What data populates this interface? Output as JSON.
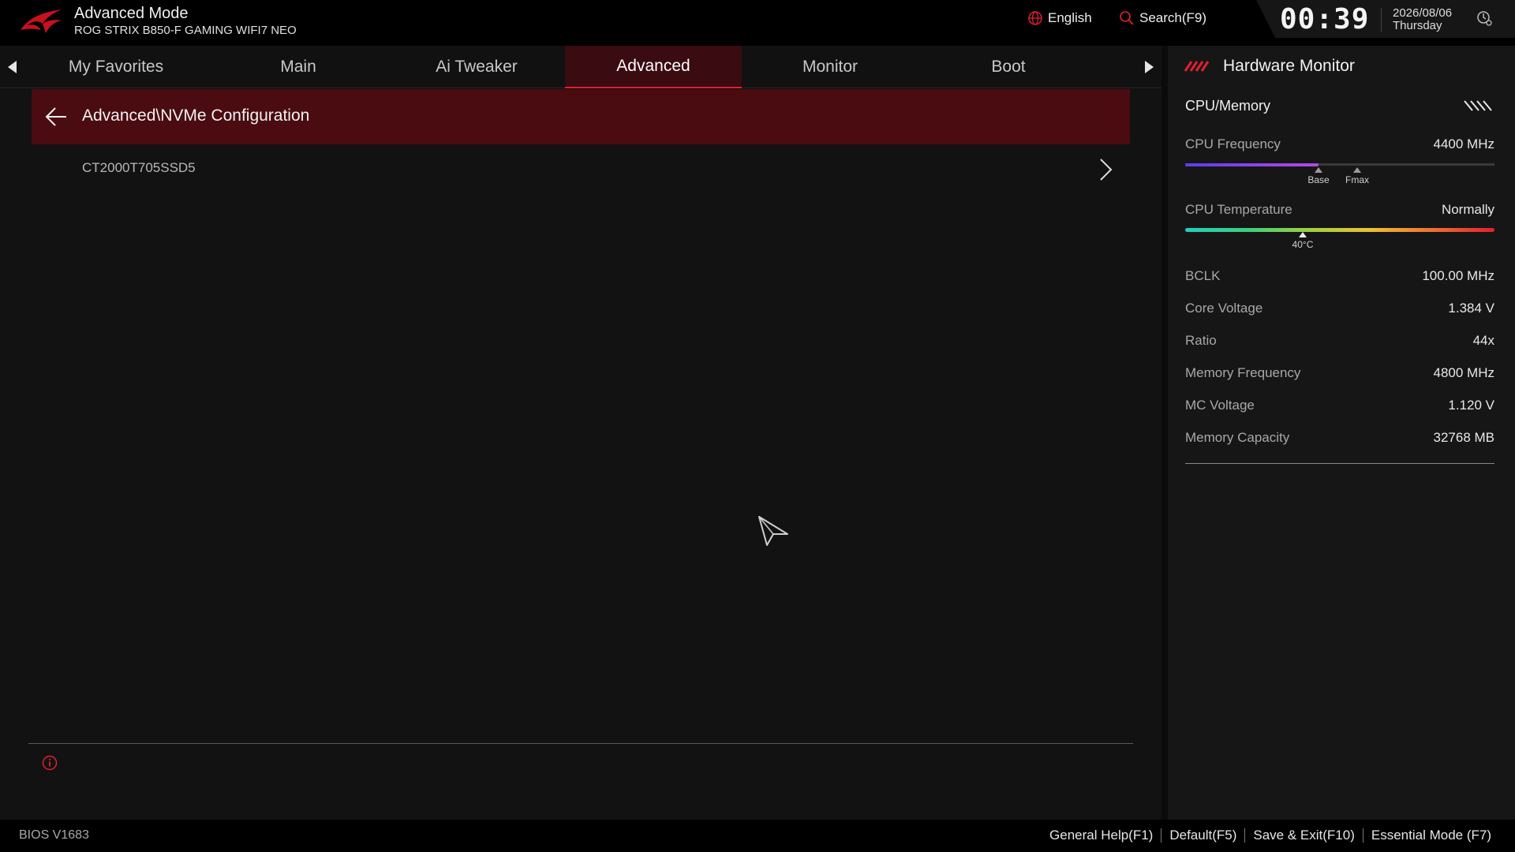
{
  "header": {
    "mode": "Advanced Mode",
    "board": "ROG STRIX B850-F GAMING WIFI7 NEO",
    "language": "English",
    "search": "Search(F9)",
    "clock": "00:39",
    "date": "2026/08/06",
    "weekday": "Thursday",
    "icons": {
      "logo": "rog-logo",
      "language": "globe-icon",
      "search": "search-icon",
      "clock_settings": "clock-gear-icon"
    }
  },
  "tabs": [
    {
      "label": "My Favorites",
      "active": false
    },
    {
      "label": "Main",
      "active": false
    },
    {
      "label": "Ai Tweaker",
      "active": false
    },
    {
      "label": "Advanced",
      "active": true
    },
    {
      "label": "Monitor",
      "active": false
    },
    {
      "label": "Boot",
      "active": false
    }
  ],
  "main": {
    "breadcrumb": "Advanced\\NVMe Configuration",
    "items": [
      {
        "label": "CT2000T705SSD5"
      }
    ]
  },
  "monitor": {
    "title": "Hardware Monitor",
    "section": "CPU/Memory",
    "cpu_frequency": {
      "label": "CPU Frequency",
      "value": "4400 MHz",
      "fill_fraction": 0.43,
      "base_label": "Base",
      "fmax_label": "Fmax"
    },
    "cpu_temperature": {
      "label": "CPU Temperature",
      "value": "Normally",
      "marker_label": "40°C",
      "marker_fraction": 0.38
    },
    "rows": [
      {
        "label": "BCLK",
        "value": "100.00 MHz"
      },
      {
        "label": "Core Voltage",
        "value": "1.384 V"
      },
      {
        "label": "Ratio",
        "value": "44x"
      },
      {
        "label": "Memory Frequency",
        "value": "4800 MHz"
      },
      {
        "label": "MC Voltage",
        "value": "1.120 V"
      },
      {
        "label": "Memory Capacity",
        "value": "32768 MB"
      }
    ]
  },
  "footer": {
    "bios_version": "BIOS V1683",
    "items": [
      "General Help(F1)",
      "Default(F5)",
      "Save & Exit(F10)",
      "Essential Mode (F7)"
    ]
  },
  "colors": {
    "accent": "#e0202e",
    "breadcrumb_bg": "#4a0c11",
    "active_tab_bg": "#3a0b10"
  }
}
